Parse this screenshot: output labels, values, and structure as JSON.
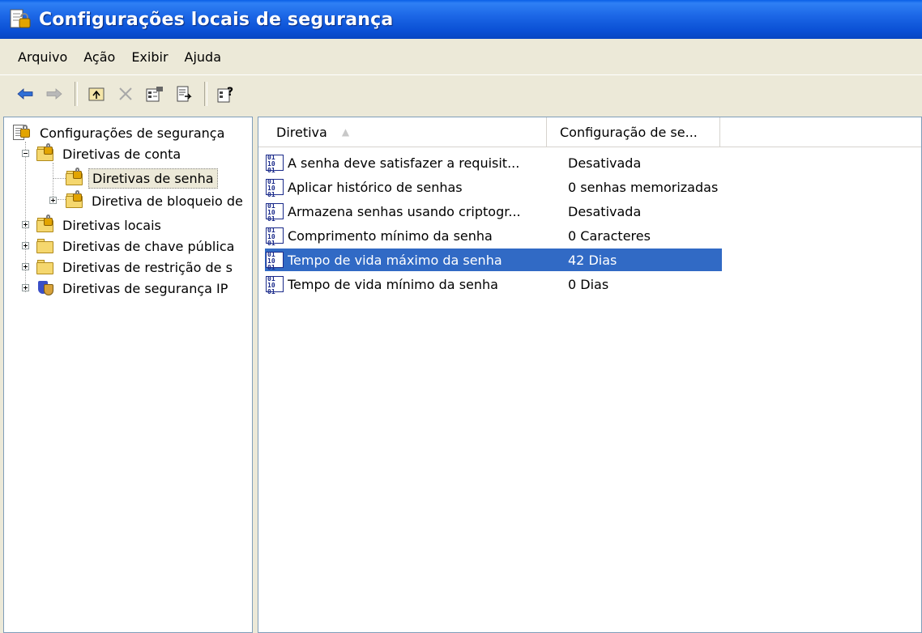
{
  "window": {
    "title": "Configurações locais de segurança"
  },
  "menu": [
    "Arquivo",
    "Ação",
    "Exibir",
    "Ajuda"
  ],
  "toolbar": {
    "buttons": [
      "back-arrow-icon",
      "forward-arrow-icon",
      "up-folder-icon",
      "delete-icon",
      "properties-icon",
      "export-list-icon",
      "help-icon"
    ]
  },
  "tree": {
    "root": "Configurações de segurança",
    "nodes": [
      {
        "label": "Diretivas de conta",
        "expanded": true
      },
      {
        "label": "Diretivas de senha",
        "selected": true
      },
      {
        "label": "Diretiva de bloqueio de"
      },
      {
        "label": "Diretivas locais"
      },
      {
        "label": "Diretivas de chave pública"
      },
      {
        "label": "Diretivas de restrição de s"
      },
      {
        "label": "Diretivas de segurança IP"
      }
    ]
  },
  "list": {
    "columns": [
      "Diretiva",
      "Configuração de se..."
    ],
    "rows": [
      {
        "policy": "A senha deve satisfazer a requisit...",
        "setting": "Desativada"
      },
      {
        "policy": "Aplicar histórico de senhas",
        "setting": "0 senhas memorizadas"
      },
      {
        "policy": "Armazena senhas usando criptogr...",
        "setting": "Desativada"
      },
      {
        "policy": "Comprimento mínimo da senha",
        "setting": "0 Caracteres"
      },
      {
        "policy": "Tempo de vida máximo da senha",
        "setting": "42 Dias",
        "selected": true
      },
      {
        "policy": "Tempo de vida mínimo da senha",
        "setting": "0 Dias"
      }
    ]
  },
  "colors": {
    "titlebar": "#0a4fd4",
    "selection": "#316ac5",
    "chrome": "#ece9d8"
  }
}
